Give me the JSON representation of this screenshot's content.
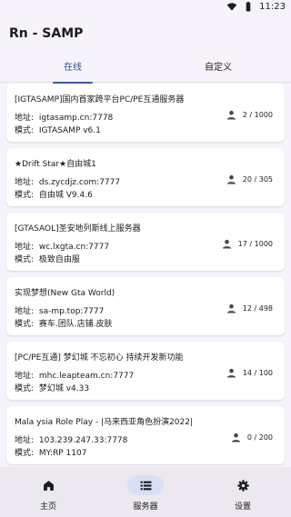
{
  "status_bar": {
    "time": "11:23",
    "icons": [
      "wifi-icon",
      "battery-icon"
    ]
  },
  "app": {
    "title": "Rn - SAMP"
  },
  "tabs": [
    {
      "label": "在线",
      "active": true
    },
    {
      "label": "自定义",
      "active": false
    }
  ],
  "labels": {
    "address": "地址:",
    "mode": "模式:"
  },
  "servers": [
    {
      "name": "[IGTASAMP]国内首家跨平台PC/PE互通服务器",
      "address": "igtasamp.cn:7778",
      "mode": "IGTASAMP v6.1",
      "players": "2 / 1000"
    },
    {
      "name": "★Drift Star★自由城1",
      "address": "ds.zycdjz.com:7777",
      "mode": "自由城 V9.4.6",
      "players": "20 / 305"
    },
    {
      "name": "[GTASAOL]圣安地列斯线上服务器",
      "address": "wc.lxgta.cn:7777",
      "mode": "极致自由服",
      "players": "17 / 1000"
    },
    {
      "name": "实现梦想(New Gta World)",
      "address": "sa-mp.top:7777",
      "mode": "赛车.团队.店铺.皮肤",
      "players": "12 / 498"
    },
    {
      "name": "[PC/PE互通] 梦幻城 不忘初心 持续开发新功能",
      "address": "mhc.leapteam.cn:7777",
      "mode": "梦幻城 v4.33",
      "players": "14 / 100"
    },
    {
      "name": "Mala ysia Role Play - |马来西亚角色扮演2022|",
      "address": "103.239.247.33:7778",
      "mode": "MY:RP 1107",
      "players": "0 / 200"
    }
  ],
  "bottom_nav": [
    {
      "label": "主页",
      "icon": "home-icon",
      "active": false
    },
    {
      "label": "服务器",
      "icon": "server-list-icon",
      "active": true
    },
    {
      "label": "设置",
      "icon": "gear-icon",
      "active": false
    }
  ],
  "colors": {
    "accent": "#3b5b9c",
    "background": "#f7f3fa",
    "nav_background": "#ece8f0",
    "active_pill": "#d8e0f6"
  }
}
